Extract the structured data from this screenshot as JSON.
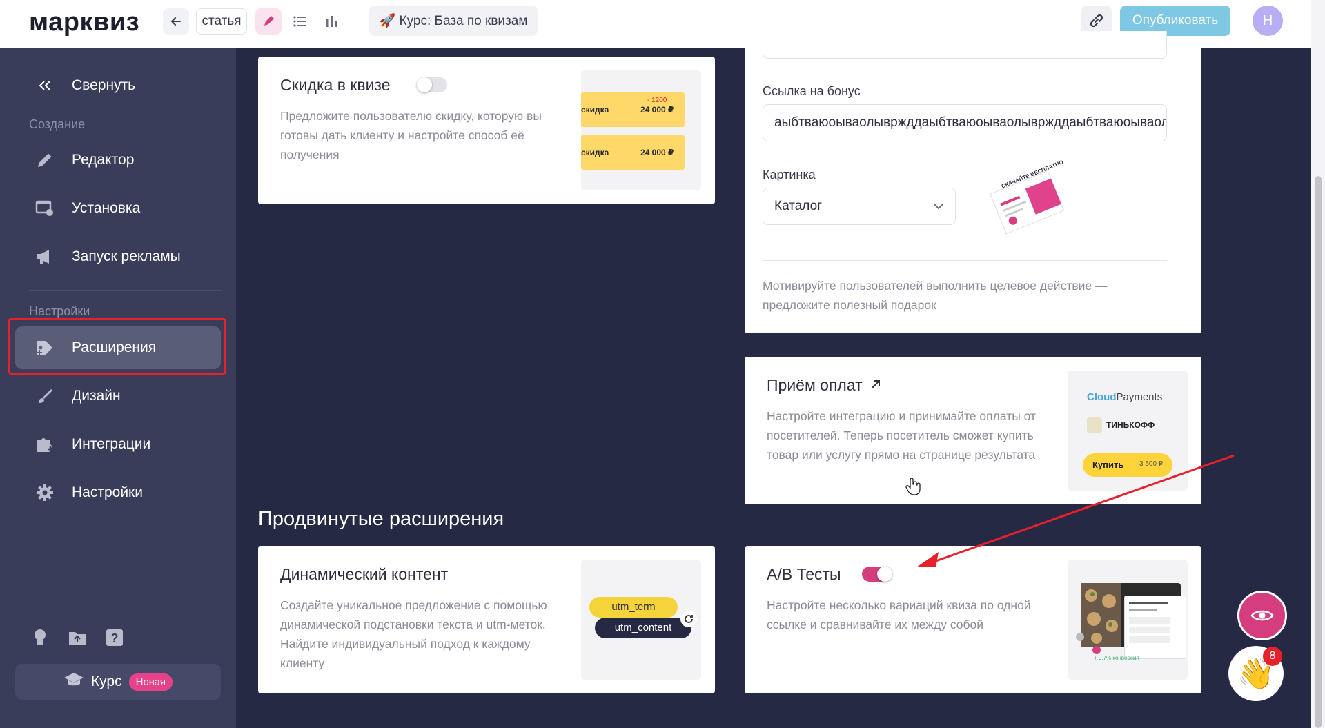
{
  "topbar": {
    "logo": "марквиз",
    "state_label": "статья",
    "quiz_title": "🚀 Курс: База по квизам",
    "publish_label": "Опубликовать",
    "avatar_letter": "Н",
    "accent_color": "#7ec8e3"
  },
  "sidebar": {
    "collapse_label": "Свернуть",
    "section_create": "Создание",
    "section_settings": "Настройки",
    "items": [
      {
        "label": "Редактор",
        "icon": "pencil-icon"
      },
      {
        "label": "Установка",
        "icon": "install-icon"
      },
      {
        "label": "Запуск рекламы",
        "icon": "megaphone-icon"
      },
      {
        "label": "Расширения",
        "icon": "puzzle-tag-icon",
        "active": true
      },
      {
        "label": "Дизайн",
        "icon": "brush-icon"
      },
      {
        "label": "Интеграции",
        "icon": "puzzle-icon"
      },
      {
        "label": "Настройки",
        "icon": "gear-icon"
      }
    ],
    "course_label": "Курс",
    "course_badge": "Новая"
  },
  "discount_card": {
    "title": "Скидка в квизе",
    "enabled": false,
    "desc": "Предложите пользователю скидку, которую вы готовы дать клиенту и настройте способ её получения",
    "thumb_rows": [
      {
        "label": "скидка",
        "price": "24 000 ₽",
        "old": "- 1200"
      },
      {
        "label": "скидка",
        "price": "24 000 ₽",
        "old": ""
      }
    ]
  },
  "bonus_card": {
    "link_label": "Ссылка на бонус",
    "link_value": "аыбтваюоываолывржддаыбтваюоываолывржддаыбтваюоываол",
    "picture_label": "Картинка",
    "picture_value": "Каталог",
    "picture_caption": "СКАЧАЙТЕ БЕСПЛАТНО",
    "desc": "Мотивируйте пользователей выполнить целевое действие — предложите полезный подарок"
  },
  "payments_card": {
    "title": "Приём оплат",
    "desc": "Настройте интеграцию и принимайте оплаты от посетителей. Теперь посетитель сможет купить товар или услугу прямо на странице результата",
    "logo_cloud": "Cloud",
    "logo_payments": "Payments",
    "logo_tinkoff": "ТИНЬКОФФ",
    "buy_label": "Купить",
    "buy_price": "3 500 ₽"
  },
  "advanced": {
    "section_title": "Продвинутые расширения",
    "dynamic_card": {
      "title": "Динамический контент",
      "desc": "Создайте уникальное предложение с помощью динамической подстановки текста и utm-меток. Найдите индивидуальный подход к каждому клиенту",
      "tag1": "utm_term",
      "tag2": "utm_content"
    },
    "ab_card": {
      "title": "A/B Тесты",
      "enabled": true,
      "desc": "Настройте несколько вариаций квиза по одной ссылке и сравнивайте их между собой",
      "thumb_caption": "+ 0.7% конверсия"
    }
  },
  "fab": {
    "notifications_count": "8",
    "wave_emoji": "👋"
  }
}
